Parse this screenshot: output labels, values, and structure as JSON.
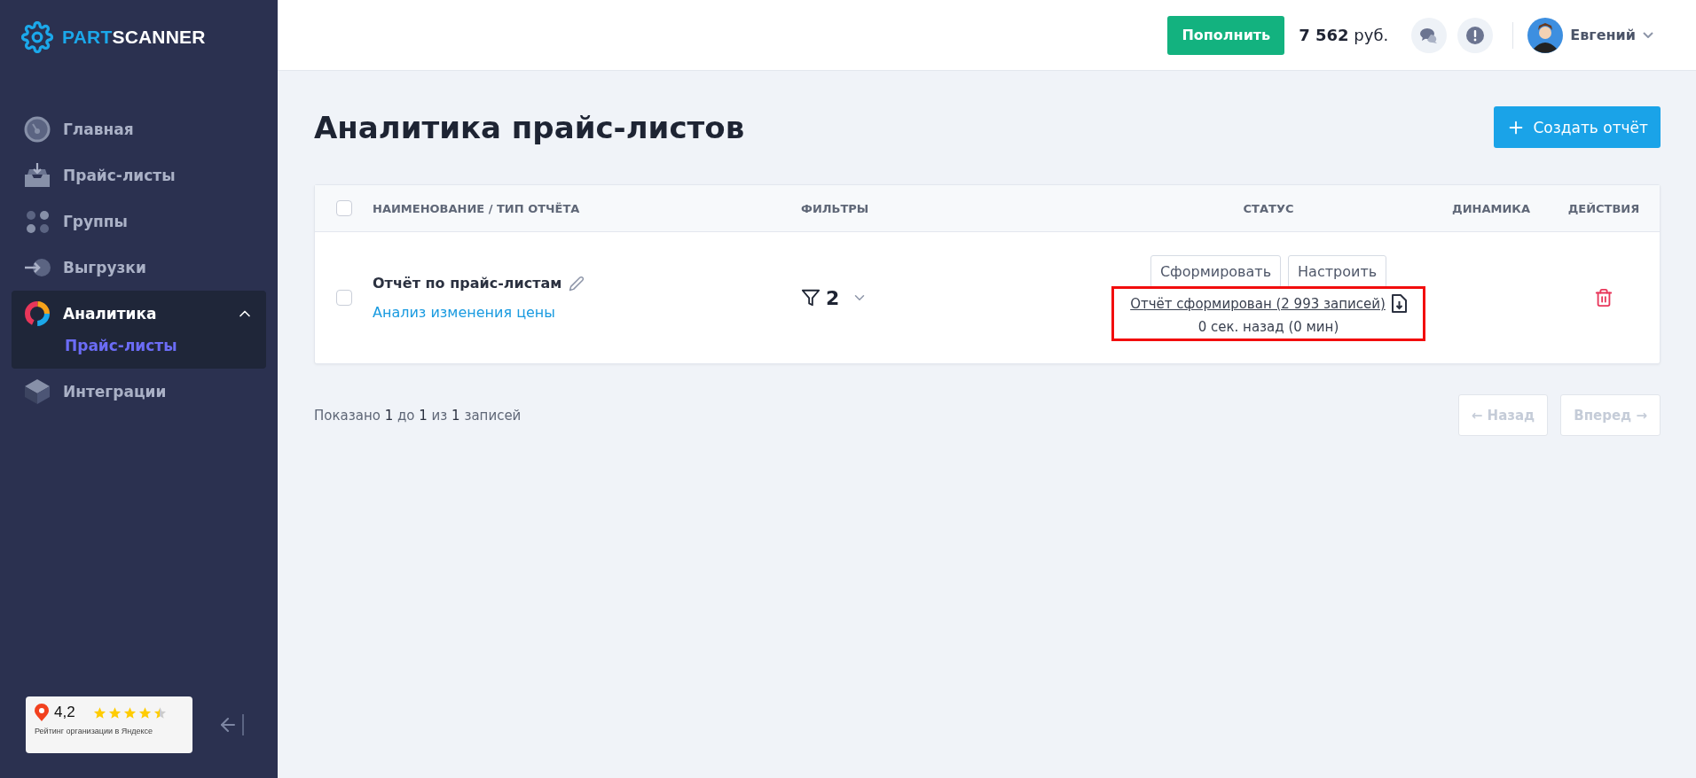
{
  "brand": {
    "part1": "PART",
    "part2": "SCANNER"
  },
  "sidebar": {
    "items": [
      {
        "label": "Главная",
        "selected": false,
        "expanded": false
      },
      {
        "label": "Прайс-листы",
        "selected": false,
        "expanded": false
      },
      {
        "label": "Группы",
        "selected": false,
        "expanded": false
      },
      {
        "label": "Выгрузки",
        "selected": false,
        "expanded": false
      },
      {
        "label": "Аналитика",
        "selected": true,
        "expanded": true,
        "children": [
          {
            "label": "Прайс-листы",
            "selected": true
          }
        ]
      },
      {
        "label": "Интеграции",
        "selected": false,
        "expanded": false
      }
    ],
    "rating": {
      "score": "4,2",
      "stars": 4.5,
      "caption": "Рейтинг организации в Яндексе"
    }
  },
  "topbar": {
    "topup": "Пополнить",
    "balance": "7 562",
    "currency": "руб.",
    "user": "Евгений"
  },
  "page": {
    "title": "Аналитика прайс-листов",
    "create": "Создать отчёт"
  },
  "table": {
    "columns": [
      "НАИМЕНОВАНИЕ / ТИП ОТЧЁТА",
      "ФИЛЬТРЫ",
      "СТАТУС",
      "ДИНАМИКА",
      "ДЕЙСТВИЯ"
    ],
    "all_checked": false,
    "rows": [
      {
        "checked": false,
        "title": "Отчёт по прайс-листам",
        "type": "Анализ изменения цены",
        "filters": "2",
        "actions": [
          "Сформировать",
          "Настроить"
        ],
        "status": "Отчёт сформирован (2 993 записей)",
        "time": "0 сек. назад (0 мин)",
        "highlighted": true
      }
    ]
  },
  "pagination": {
    "summary": "Показано **1** до **1** из **1** записей",
    "prev": {
      "label": "← Назад",
      "disabled": true
    },
    "next": {
      "label": "Вперед →",
      "disabled": true
    }
  }
}
